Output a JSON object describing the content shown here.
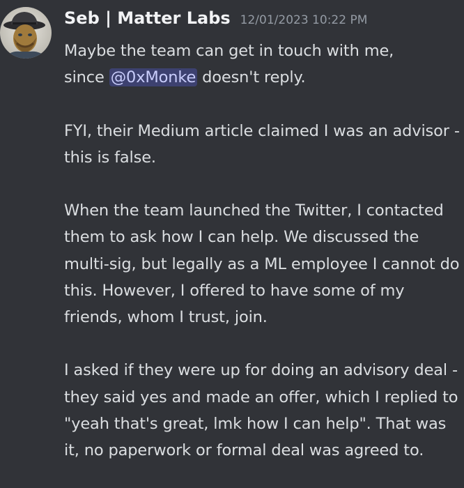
{
  "message": {
    "author": "Seb | Matter Labs",
    "timestamp": "12/01/2023 10:22 PM",
    "avatar_icon": "avatar-icon",
    "mention": "@0xMonke",
    "line1_before": "Maybe the team can get in touch with me,",
    "line2_before": "since ",
    "line2_after": " doesn't reply.",
    "para2": "FYI, their Medium article claimed I was an advisor - this is false.",
    "para3": "When the team launched the Twitter, I contacted them to ask how I can help. We discussed the multi-sig, but legally as a ML employee I cannot do this. However, I offered to have some of my friends, whom I trust, join.",
    "para4": "I asked if they were up for doing an advisory deal - they said yes and made an offer, which I replied to \"yeah that's great, lmk how I can help\". That was it, no paperwork or formal deal was agreed to."
  },
  "colors": {
    "background": "#313338",
    "username": "#f2f3f5",
    "timestamp": "#949ba4",
    "text": "#dbdee1",
    "mention_bg": "#3c4270",
    "mention_text": "#c9cdfb"
  }
}
